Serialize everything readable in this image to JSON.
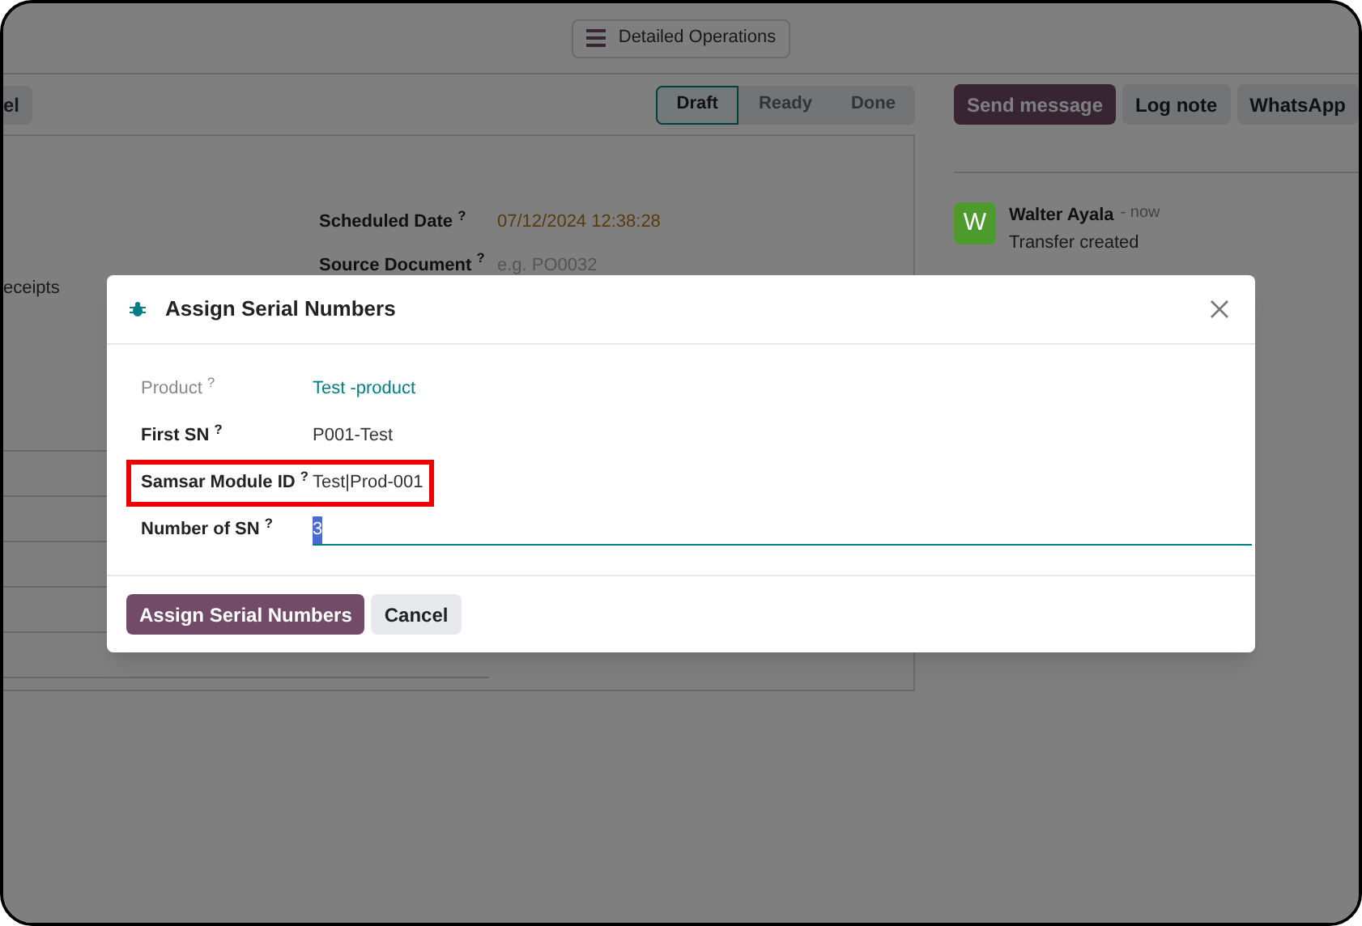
{
  "top_bar": {
    "button": "Detailed Operations"
  },
  "control_panel": {
    "left_button": "el",
    "stages": [
      {
        "label": "Draft",
        "selected": true
      },
      {
        "label": "Ready",
        "selected": false
      },
      {
        "label": "Done",
        "selected": false
      }
    ],
    "chatter_buttons": [
      {
        "label": "Send message",
        "primary": true
      },
      {
        "label": "Log note",
        "primary": false
      },
      {
        "label": "WhatsApp",
        "primary": false
      }
    ]
  },
  "form": {
    "left_text": "eceipts",
    "fields": [
      {
        "label": "Scheduled Date $^{?}$",
        "value": "07/12/2024 12:38:28",
        "kind": "date"
      },
      {
        "label": "Source Document $^{?}$",
        "placeholder": "e.g. PO0032",
        "kind": "empty"
      }
    ]
  },
  "chatter": {
    "messages": [
      {
        "avatar": "W",
        "color": "#4e9a2c",
        "author": "Walter Ayala",
        "time": "- now",
        "body": "Transfer created"
      }
    ]
  },
  "dialog": {
    "title": "Assign Serial Numbers",
    "fields": [
      {
        "label": "Product $^{?}$",
        "kind": "link",
        "value": "Test -product",
        "highlighted": false
      },
      {
        "label": "First SN $^{?}$",
        "kind": "text",
        "value": "P001-Test",
        "highlighted": false
      },
      {
        "label": "Samsar Module ID $^{?}$",
        "kind": "text",
        "value": "Test|Prod-001",
        "highlighted": true
      },
      {
        "label": "Number of SN $^{?}$",
        "kind": "input",
        "value": "3",
        "highlighted": false
      }
    ],
    "buttons": [
      {
        "label": "Assign Serial Numbers",
        "primary": true
      },
      {
        "label": "Cancel",
        "primary": false
      }
    ]
  }
}
